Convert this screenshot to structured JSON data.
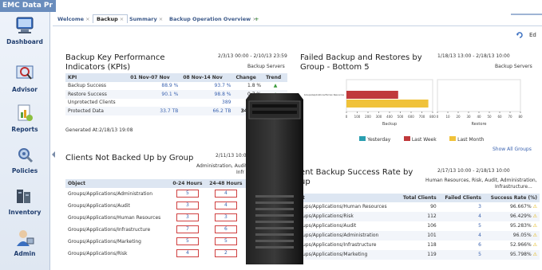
{
  "app": {
    "title": "EMC Data Pr"
  },
  "sidebar": {
    "items": [
      {
        "label": "Dashboard",
        "icon": "dashboard-icon"
      },
      {
        "label": "Advisor",
        "icon": "advisor-icon"
      },
      {
        "label": "Reports",
        "icon": "reports-icon"
      },
      {
        "label": "Policies",
        "icon": "policies-icon"
      },
      {
        "label": "Inventory",
        "icon": "inventory-icon"
      },
      {
        "label": "Admin",
        "icon": "admin-icon"
      }
    ]
  },
  "tabs": [
    {
      "label": "Welcome",
      "close": "×"
    },
    {
      "label": "Backup",
      "close": "×"
    },
    {
      "label": "Summary",
      "close": "×"
    },
    {
      "label": "Backup Operation Overview",
      "close": "×"
    },
    {
      "label": "+"
    }
  ],
  "toolbar": {
    "edit_label": "Ed"
  },
  "kpi": {
    "title_line1": "Backup Key Performance",
    "title_line2": "Indicators (KPIs)",
    "date_range": "2/3/13 00:00 - 2/10/13 23:59",
    "scope": "Backup Servers",
    "headers": [
      "KPI",
      "01 Nov-07 Nov",
      "08 Nov-14 Nov",
      "Change",
      "Trend"
    ],
    "rows": [
      [
        "Backup Success",
        "88.9 %",
        "93.7 %",
        "1.8 %",
        ""
      ],
      [
        "Restore Success",
        "90.1 %",
        "98.8 %",
        "0.7 %",
        ""
      ],
      [
        "Unprotected Clients",
        "",
        "389",
        "",
        ""
      ],
      [
        "Protected Data",
        "33.7 TB",
        "66.2 TB",
        "34.5 TB",
        ""
      ]
    ],
    "generated": "Generated At:2/18/13 19:08"
  },
  "failed": {
    "title_line1": "Failed Backup and Restores by",
    "title_line2": "Group - Bottom 5",
    "date_range": "1/18/13 13:00 - 2/18/13 10:00",
    "scope": "Backup Servers",
    "bar_label": "Groups/Applications/Human Resources",
    "backup_ticks": [
      "0",
      "100",
      "200",
      "300",
      "400",
      "500",
      "600",
      "700",
      "800"
    ],
    "restore_ticks": [
      "0",
      "10",
      "20",
      "30",
      "40",
      "50",
      "60",
      "70",
      "80"
    ],
    "backup_axis": "Backup",
    "restore_axis": "Restore",
    "legend": [
      "Yesterday",
      "Last Week",
      "Last Month"
    ],
    "colors": [
      "#2a9fb0",
      "#c0393b",
      "#f0c23a"
    ],
    "show_all": "Show All Groups",
    "chart_data": {
      "type": "bar",
      "categories": [
        "Groups/Applications/Human Resources"
      ],
      "series": [
        {
          "name": "Yesterday",
          "values": [
            0
          ]
        },
        {
          "name": "Last Week",
          "values": [
            480
          ]
        },
        {
          "name": "Last Month",
          "values": [
            760
          ]
        }
      ]
    }
  },
  "clients": {
    "title": "Clients Not Backed Up by Group",
    "date_range": "2/11/13 10:0",
    "scope_line1": "Administration, Audit, G",
    "scope_line2": "Infr",
    "headers": [
      "Object",
      "0-24 Hours",
      "24-48 Hours"
    ],
    "rows": [
      [
        "Groups/Applications/Administration",
        "5",
        "4"
      ],
      [
        "Groups/Applications/Audit",
        "3",
        "4"
      ],
      [
        "Groups/Applications/Human Resources",
        "3",
        "3"
      ],
      [
        "Groups/Applications/Infrastructure",
        "7",
        "6"
      ],
      [
        "Groups/Applications/Marketing",
        "5",
        "5"
      ],
      [
        "Groups/Applications/Risk",
        "4",
        "2"
      ]
    ]
  },
  "success": {
    "title_line1": "ent Backup Success Rate by",
    "title_line2": "up",
    "date_range": "2/17/13 10:00 - 2/18/13 10:00",
    "scope_line1": "Human Resources, Risk, Audit, Administration,",
    "scope_line2": "Infrastructure...",
    "headers": [
      "t",
      "Total Clients",
      "Failed Clients",
      "Success Rate (%)"
    ],
    "rows": [
      [
        "ups/Applications/Human Resources",
        "90",
        "3",
        "96.667%"
      ],
      [
        "ups/Applications/Risk",
        "112",
        "4",
        "96.429%"
      ],
      [
        "ups/Applications/Audit",
        "106",
        "5",
        "95.283%"
      ],
      [
        "ups/Applications/Administration",
        "101",
        "4",
        "96.05%"
      ],
      [
        "ups/Applications/Infrastructure",
        "118",
        "6",
        "52.966%"
      ],
      [
        "ups/Applications/Marketing",
        "119",
        "5",
        "95.798%"
      ]
    ]
  }
}
